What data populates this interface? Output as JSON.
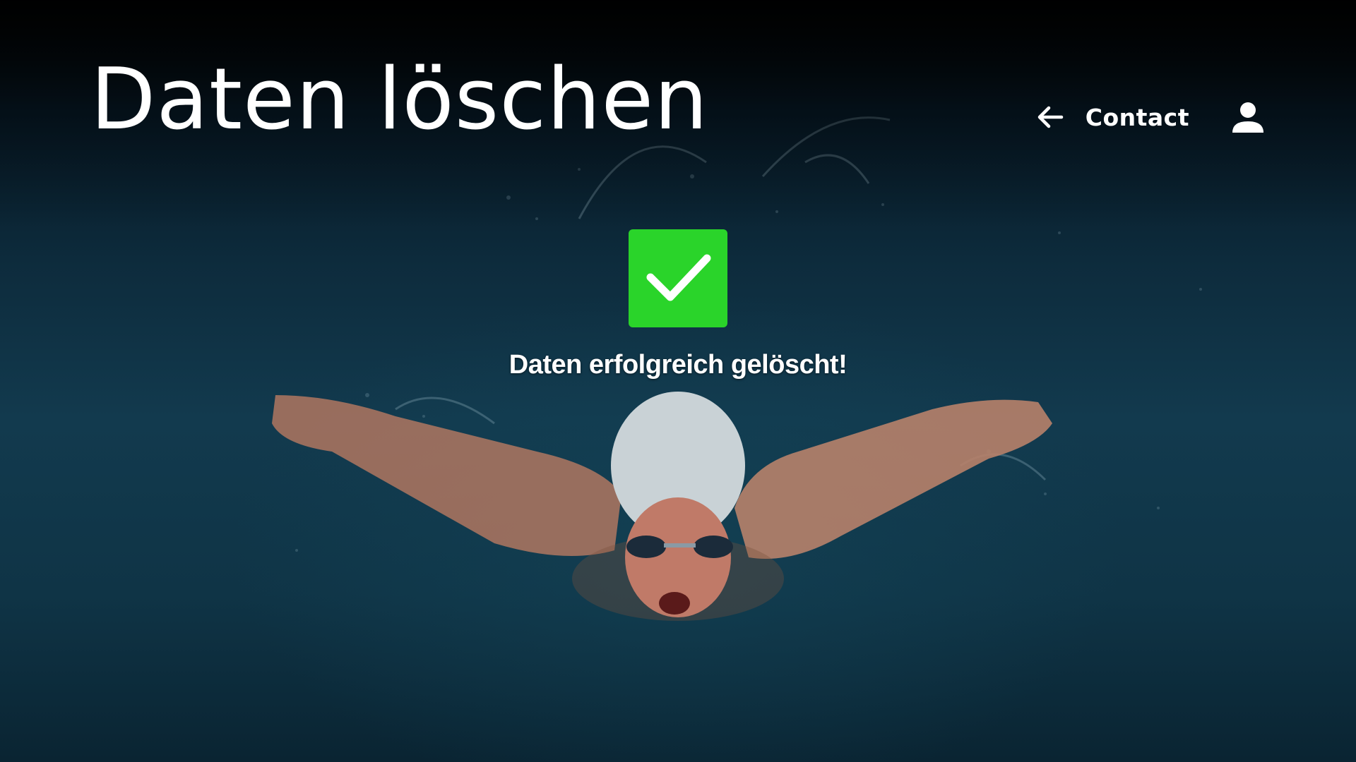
{
  "page": {
    "title": "Daten löschen"
  },
  "nav": {
    "back_icon": "arrow-left-icon",
    "contact_label": "Contact",
    "user_icon": "user-icon"
  },
  "status": {
    "icon": "checkmark-icon",
    "badge_color": "#2ad42a",
    "message": "Daten erfolgreich gelöscht!"
  },
  "background": {
    "description_icon": "swimmer-photo"
  }
}
